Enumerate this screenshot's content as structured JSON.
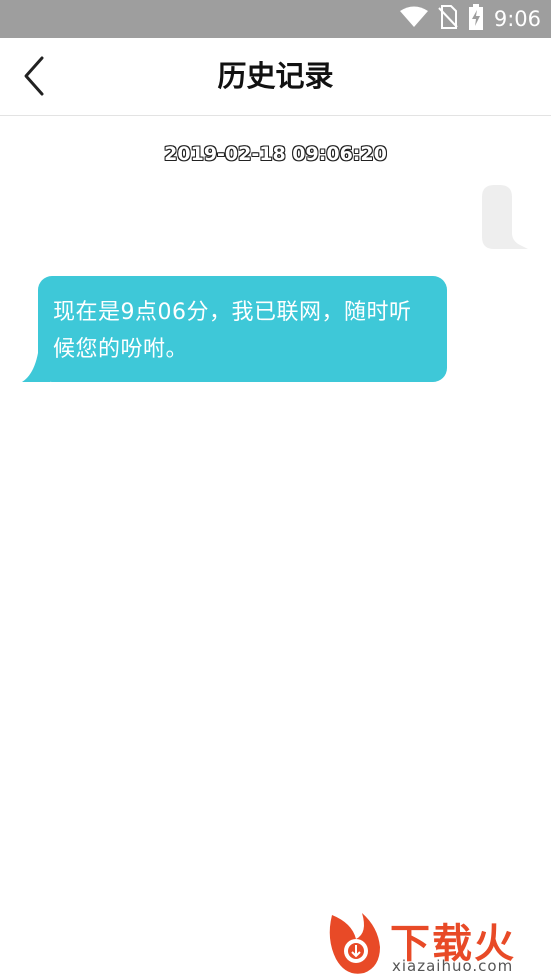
{
  "status_bar": {
    "time": "9:06",
    "icons": [
      "wifi-icon",
      "no-sim-icon",
      "battery-charging-icon"
    ]
  },
  "header": {
    "title": "历史记录",
    "back_icon": "chevron-left-icon"
  },
  "conversation": {
    "timestamp": "2019-02-18 09:06:20",
    "user_message": "",
    "bot_message": "现在是9点06分，我已联网，随时听候您的吩咐。"
  },
  "watermark": {
    "brand": "下载火",
    "url": "xiazaihuo.com"
  },
  "colors": {
    "status_bar_bg": "#9e9e9e",
    "bot_bubble": "#3ec8d8",
    "user_bubble": "#eeeeee",
    "watermark_brand": "#e84a27"
  }
}
